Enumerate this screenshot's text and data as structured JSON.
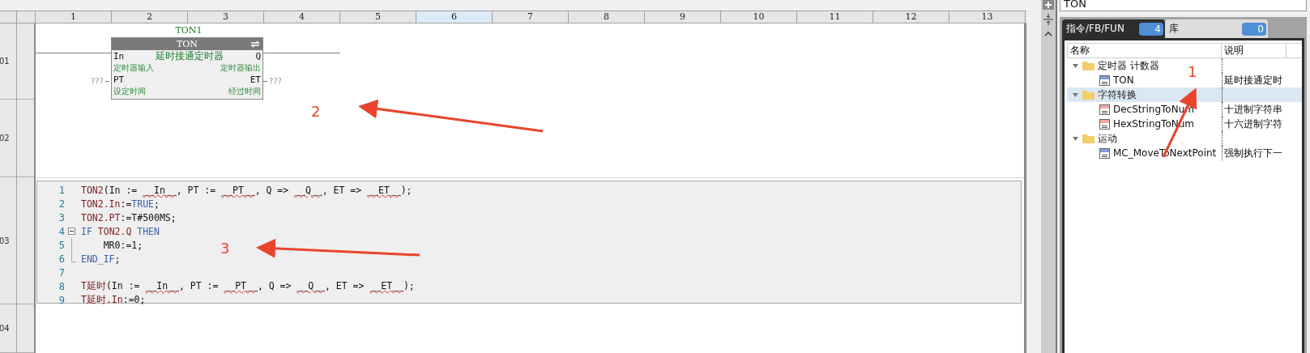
{
  "ruler": {
    "columns": [
      {
        "label": "1",
        "selected": false
      },
      {
        "label": "2",
        "selected": false
      },
      {
        "label": "3",
        "selected": false
      },
      {
        "label": "4",
        "selected": false
      },
      {
        "label": "5",
        "selected": false
      },
      {
        "label": "6",
        "selected": true
      },
      {
        "label": "7",
        "selected": false
      },
      {
        "label": "8",
        "selected": false
      },
      {
        "label": "9",
        "selected": false
      },
      {
        "label": "10",
        "selected": false
      },
      {
        "label": "11",
        "selected": false
      },
      {
        "label": "12",
        "selected": false
      },
      {
        "label": "13",
        "selected": false
      }
    ]
  },
  "rows": [
    {
      "label": "01"
    },
    {
      "label": "02"
    },
    {
      "label": "03"
    },
    {
      "label": "04"
    }
  ],
  "ladder": {
    "instance": "TON1",
    "block": {
      "type": "TON",
      "title": "延时接通定时器",
      "pins": [
        {
          "left": "In",
          "left_note": "定时器输入",
          "right": "Q",
          "right_note": "定时器输出"
        },
        {
          "left": "PT",
          "left_note": "设定时间",
          "right": "ET",
          "right_note": "经过时间",
          "left_value": "???",
          "right_value": "???"
        }
      ]
    }
  },
  "code": {
    "lines": [
      {
        "number": "1",
        "kind": "normal",
        "tokens": [
          {
            "kind": "ident",
            "text": "TON2"
          },
          {
            "kind": "plain",
            "text": "(In := "
          },
          {
            "kind": "placeholder",
            "text": "__In__"
          },
          {
            "kind": "plain",
            "text": ", PT := "
          },
          {
            "kind": "placeholder",
            "text": "__PT__"
          },
          {
            "kind": "plain",
            "text": ", Q => "
          },
          {
            "kind": "placeholder",
            "text": "__Q__"
          },
          {
            "kind": "plain",
            "text": ", ET => "
          },
          {
            "kind": "placeholder",
            "text": "__ET__"
          },
          {
            "kind": "plain",
            "text": ");"
          }
        ]
      },
      {
        "number": "2",
        "kind": "normal",
        "tokens": [
          {
            "kind": "ident",
            "text": "TON2.In"
          },
          {
            "kind": "plain",
            "text": ":="
          },
          {
            "kind": "keyword",
            "text": "TRUE"
          },
          {
            "kind": "plain",
            "text": ";"
          }
        ]
      },
      {
        "number": "3",
        "kind": "normal",
        "tokens": [
          {
            "kind": "ident",
            "text": "TON2.PT"
          },
          {
            "kind": "plain",
            "text": ":=T#500MS;"
          }
        ]
      },
      {
        "number": "4",
        "kind": "branch",
        "tokens": [
          {
            "kind": "keyword",
            "text": "IF "
          },
          {
            "kind": "ident",
            "text": "TON2.Q"
          },
          {
            "kind": "keyword",
            "text": " THEN"
          }
        ]
      },
      {
        "number": "5",
        "kind": "nested",
        "tokens": [
          {
            "kind": "plain",
            "text": "    MR0:=1;"
          }
        ]
      },
      {
        "number": "6",
        "kind": "closing",
        "tokens": [
          {
            "kind": "keyword",
            "text": "END_IF"
          },
          {
            "kind": "plain",
            "text": ";"
          }
        ]
      },
      {
        "number": "7",
        "kind": "normal"
      },
      {
        "number": "8",
        "kind": "normal",
        "tokens": [
          {
            "kind": "ident",
            "text": "T延时"
          },
          {
            "kind": "plain",
            "text": "(In := "
          },
          {
            "kind": "placeholder",
            "text": "__In__"
          },
          {
            "kind": "plain",
            "text": ", PT := "
          },
          {
            "kind": "placeholder",
            "text": "__PT__"
          },
          {
            "kind": "plain",
            "text": ", Q => "
          },
          {
            "kind": "placeholder",
            "text": "__Q__"
          },
          {
            "kind": "plain",
            "text": ", ET => "
          },
          {
            "kind": "placeholder",
            "text": "__ET__"
          },
          {
            "kind": "plain",
            "text": ");"
          }
        ]
      },
      {
        "number": "9",
        "kind": "normal",
        "tokens": [
          {
            "kind": "ident",
            "text": "T延时.In"
          },
          {
            "kind": "plain",
            "text": ":=0;"
          }
        ]
      }
    ]
  },
  "annotations": [
    "1",
    "2",
    "3"
  ],
  "search": {
    "value": "TON"
  },
  "tabs": [
    {
      "label": "指令/FB/FUN",
      "count": "4",
      "selected": true
    },
    {
      "label": "库",
      "count": "0",
      "selected": false
    }
  ],
  "tree": {
    "columns": [
      "名称",
      "说明"
    ],
    "items": [
      {
        "kind": "folder",
        "label": "定时器 计数器",
        "expanded": true,
        "selected": false,
        "children": [
          {
            "kind": "fb",
            "label": "TON",
            "description": "延时接通定时",
            "color": "#7f9fd8"
          }
        ]
      },
      {
        "kind": "folder",
        "label": "字符转换",
        "expanded": true,
        "selected": true,
        "children": [
          {
            "kind": "fb",
            "label": "DecStringToNum",
            "description": "十进制字符串",
            "color": "#f2a9a2"
          },
          {
            "kind": "fb",
            "label": "HexStringToNum",
            "description": "十六进制字符",
            "color": "#f2a9a2"
          }
        ]
      },
      {
        "kind": "folder",
        "label": "运动",
        "expanded": true,
        "selected": false,
        "children": [
          {
            "kind": "fb",
            "label": "MC_MoveToNextPoint",
            "description": "强制执行下一",
            "color": "#7f9fd8"
          }
        ]
      }
    ]
  }
}
